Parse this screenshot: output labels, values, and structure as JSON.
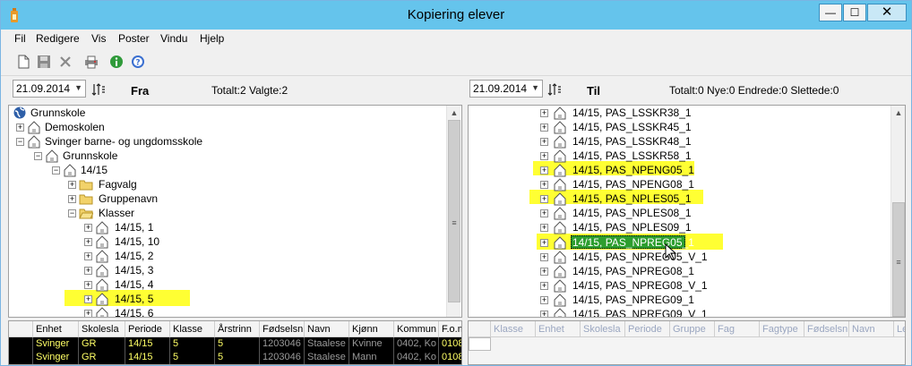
{
  "window": {
    "title": "Kopiering elever",
    "minimize": "—",
    "maximize": "☐",
    "close": "✕"
  },
  "menu": [
    "Fil",
    "Redigere",
    "Vis",
    "Poster",
    "Vindu",
    "Hjelp"
  ],
  "toolbar": {
    "icons": [
      "new-file-icon",
      "save-icon",
      "delete-icon",
      "print-icon",
      "info-icon",
      "help-icon"
    ]
  },
  "left": {
    "date": "21.09.2014",
    "label": "Fra",
    "status": "Totalt:2  Valgte:2",
    "tree": [
      {
        "text": "Grunnskole",
        "icon": "globe"
      },
      {
        "text": "Demoskolen",
        "icon": "house"
      },
      {
        "text": "Svinger barne- og ungdomsskole",
        "icon": "house"
      },
      {
        "text": "Grunnskole",
        "icon": "house"
      },
      {
        "text": "14/15",
        "icon": "house"
      },
      {
        "text": "Fagvalg",
        "icon": "folder"
      },
      {
        "text": "Gruppenavn",
        "icon": "folder"
      },
      {
        "text": "Klasser",
        "icon": "folder-open"
      },
      {
        "text": "14/15, 1",
        "icon": "house"
      },
      {
        "text": "14/15, 10",
        "icon": "house"
      },
      {
        "text": "14/15, 2",
        "icon": "house"
      },
      {
        "text": "14/15, 3",
        "icon": "house"
      },
      {
        "text": "14/15, 4",
        "icon": "house"
      },
      {
        "text": "14/15, 5",
        "icon": "house",
        "highlight": true
      },
      {
        "text": "14/15, 6",
        "icon": "house"
      }
    ],
    "grid": {
      "headers": [
        "Enhet",
        "Skolesla",
        "Periode",
        "Klasse",
        "Årstrinn",
        "Fødselsn",
        "Navn",
        "Kjønn",
        "Kommun",
        "F.o.m"
      ],
      "rows": [
        [
          "Svinger",
          "GR",
          "14/15",
          "5",
          "5",
          "1203046",
          "Staalese",
          "Kvinne",
          "0402, Ko",
          "0108"
        ],
        [
          "Svinger",
          "GR",
          "14/15",
          "5",
          "5",
          "1203046",
          "Staalese",
          "Mann",
          "0402, Ko",
          "0108"
        ]
      ]
    }
  },
  "right": {
    "date": "21.09.2014",
    "label": "Til",
    "status": "Totalt:0  Nye:0  Endrede:0  Slettede:0",
    "tree": [
      {
        "text": "14/15, PAS_LSSKR38_1"
      },
      {
        "text": "14/15, PAS_LSSKR45_1"
      },
      {
        "text": "14/15, PAS_LSSKR48_1"
      },
      {
        "text": "14/15, PAS_LSSKR58_1"
      },
      {
        "text": "14/15, PAS_NPENG05_1",
        "highlight": true
      },
      {
        "text": "14/15, PAS_NPENG08_1"
      },
      {
        "text": "14/15, PAS_NPLES05_1",
        "highlight": true
      },
      {
        "text": "14/15, PAS_NPLES08_1"
      },
      {
        "text": "14/15, PAS_NPLES09_1"
      },
      {
        "text": "14/15, PAS_NPREG05_1",
        "highlight": true,
        "selected": true
      },
      {
        "text": "14/15, PAS_NPREG05_V_1"
      },
      {
        "text": "14/15, PAS_NPREG08_1"
      },
      {
        "text": "14/15, PAS_NPREG08_V_1"
      },
      {
        "text": "14/15, PAS_NPREG09_1"
      },
      {
        "text": "14/15, PAS_NPREG09_V_1"
      }
    ],
    "grid": {
      "headers": [
        "Klasse",
        "Enhet",
        "Skolesla",
        "Periode",
        "Gruppe",
        "Fag",
        "Fagtype",
        "Fødselsn",
        "Navn",
        "Le"
      ]
    }
  },
  "colors": {
    "titlebar": "#65c4ec",
    "highlight": "#ffff33",
    "selected": "#2d9e2f",
    "grid_text": "#ffff66"
  }
}
